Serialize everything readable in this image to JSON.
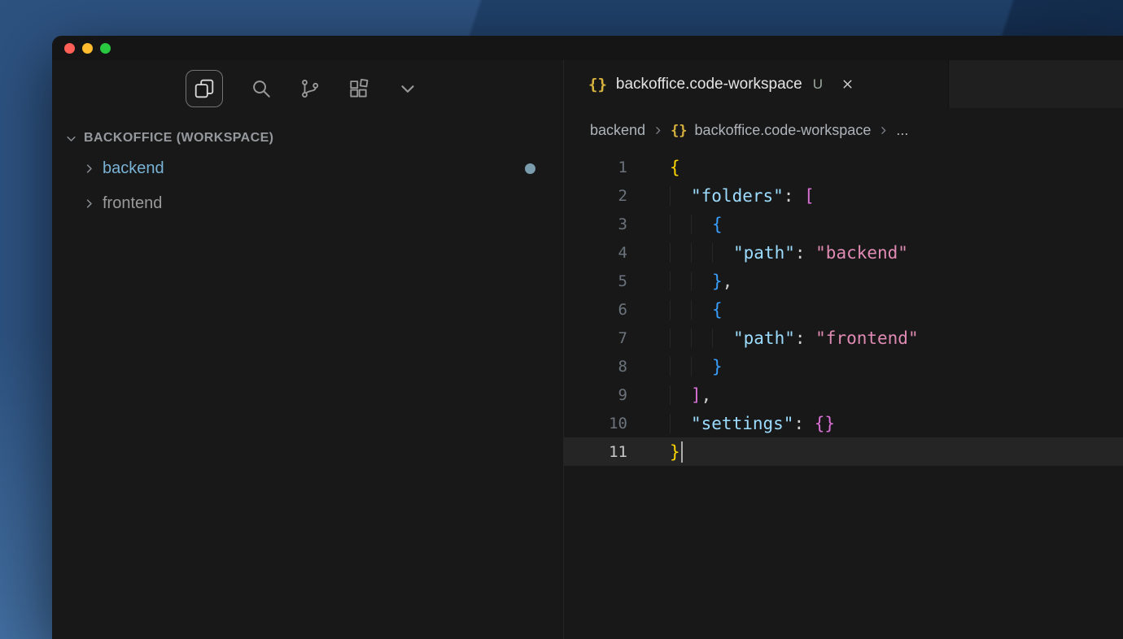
{
  "window": {
    "traffic_lights": [
      {
        "name": "close",
        "color": "#ff5f57"
      },
      {
        "name": "minimize",
        "color": "#febc2e"
      },
      {
        "name": "zoom",
        "color": "#28c840"
      }
    ]
  },
  "activity_bar": {
    "icons": [
      {
        "name": "explorer",
        "active": true
      },
      {
        "name": "search",
        "active": false
      },
      {
        "name": "source-control",
        "active": false
      },
      {
        "name": "extensions",
        "active": false
      },
      {
        "name": "more-views",
        "active": false
      }
    ]
  },
  "sidebar": {
    "section": {
      "label": "BACKOFFICE (WORKSPACE)",
      "expanded": true
    },
    "items": [
      {
        "label": "backend",
        "modified": true,
        "dot": true
      },
      {
        "label": "frontend",
        "modified": false,
        "dot": false
      }
    ]
  },
  "editor": {
    "tab": {
      "icon_glyph": "{}",
      "label": "backoffice.code-workspace",
      "badge": "U"
    },
    "breadcrumbs": [
      "backend",
      "backoffice.code-workspace",
      "..."
    ],
    "active_line": 11,
    "lines": [
      {
        "num": 1,
        "indent": 0,
        "tokens": [
          {
            "text": "{",
            "color": "bracket1"
          }
        ]
      },
      {
        "num": 2,
        "indent": 1,
        "tokens": [
          {
            "text": "\"folders\"",
            "color": "property"
          },
          {
            "text": ": ",
            "color": "punctuation"
          },
          {
            "text": "[",
            "color": "bracket2"
          }
        ]
      },
      {
        "num": 3,
        "indent": 2,
        "tokens": [
          {
            "text": "{",
            "color": "bracket3"
          }
        ]
      },
      {
        "num": 4,
        "indent": 3,
        "tokens": [
          {
            "text": "\"path\"",
            "color": "property"
          },
          {
            "text": ": ",
            "color": "punctuation"
          },
          {
            "text": "\"backend\"",
            "color": "string"
          }
        ]
      },
      {
        "num": 5,
        "indent": 2,
        "tokens": [
          {
            "text": "}",
            "color": "bracket3"
          },
          {
            "text": ",",
            "color": "punctuation"
          }
        ]
      },
      {
        "num": 6,
        "indent": 2,
        "tokens": [
          {
            "text": "{",
            "color": "bracket3"
          }
        ]
      },
      {
        "num": 7,
        "indent": 3,
        "tokens": [
          {
            "text": "\"path\"",
            "color": "property"
          },
          {
            "text": ": ",
            "color": "punctuation"
          },
          {
            "text": "\"frontend\"",
            "color": "string"
          }
        ]
      },
      {
        "num": 8,
        "indent": 2,
        "tokens": [
          {
            "text": "}",
            "color": "bracket3"
          }
        ]
      },
      {
        "num": 9,
        "indent": 1,
        "tokens": [
          {
            "text": "]",
            "color": "bracket2"
          },
          {
            "text": ",",
            "color": "punctuation"
          }
        ]
      },
      {
        "num": 10,
        "indent": 1,
        "tokens": [
          {
            "text": "\"settings\"",
            "color": "property"
          },
          {
            "text": ": ",
            "color": "punctuation"
          },
          {
            "text": "{}",
            "color": "bracket2"
          }
        ]
      },
      {
        "num": 11,
        "indent": 0,
        "tokens": [
          {
            "text": "}",
            "color": "bracket1"
          }
        ]
      }
    ]
  },
  "colors": {
    "bracket1": "#ffd700",
    "bracket2": "#da70d6",
    "bracket3": "#3aa0ff",
    "property": "#9cdcfe",
    "string": "#e08bb4",
    "punctuation": "#cfcfcf",
    "sidebar_item_default": "#9a9a9a",
    "sidebar_item_modified": "#79b3d6",
    "sidebar_dot": "#7b9cad"
  }
}
